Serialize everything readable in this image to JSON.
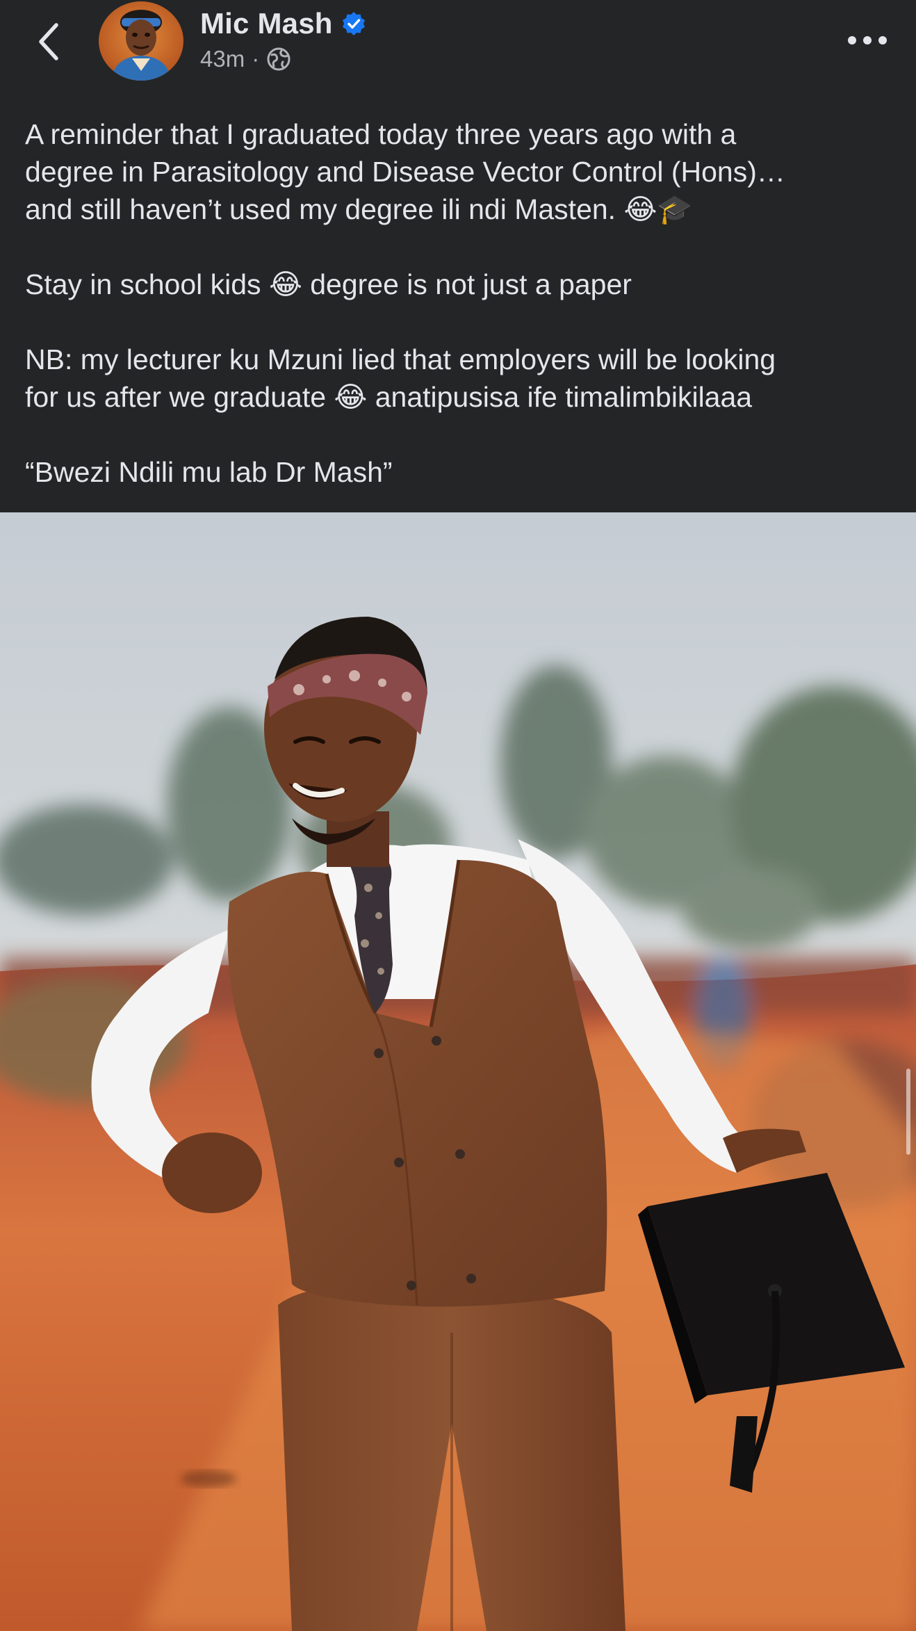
{
  "post": {
    "author": "Mic Mash",
    "time": "43m",
    "separator": "·",
    "lines": [
      "A reminder that I graduated today three years ago with a",
      "degree in Parasitology and Disease Vector Control (Hons)…",
      "and still haven’t used my degree ili ndi Masten. 😂🎓",
      "Stay in school kids 😂 degree is not just a paper",
      "NB: my lecturer ku Mzuni lied that employers will be looking",
      "for us after we graduate 😂 anatipusisa ife timalimbikilaaa",
      "“Bwezi Ndili mu lab Dr Mash”"
    ]
  },
  "icons": {
    "back": "chevron-left-icon",
    "verified": "verified-badge-icon",
    "audience": "globe-icon",
    "more": "more-horizontal-icon"
  },
  "colors": {
    "background": "#242526",
    "text_primary": "#e4e6eb",
    "text_secondary": "#b0b3b8",
    "verified_blue": "#1877f2"
  }
}
